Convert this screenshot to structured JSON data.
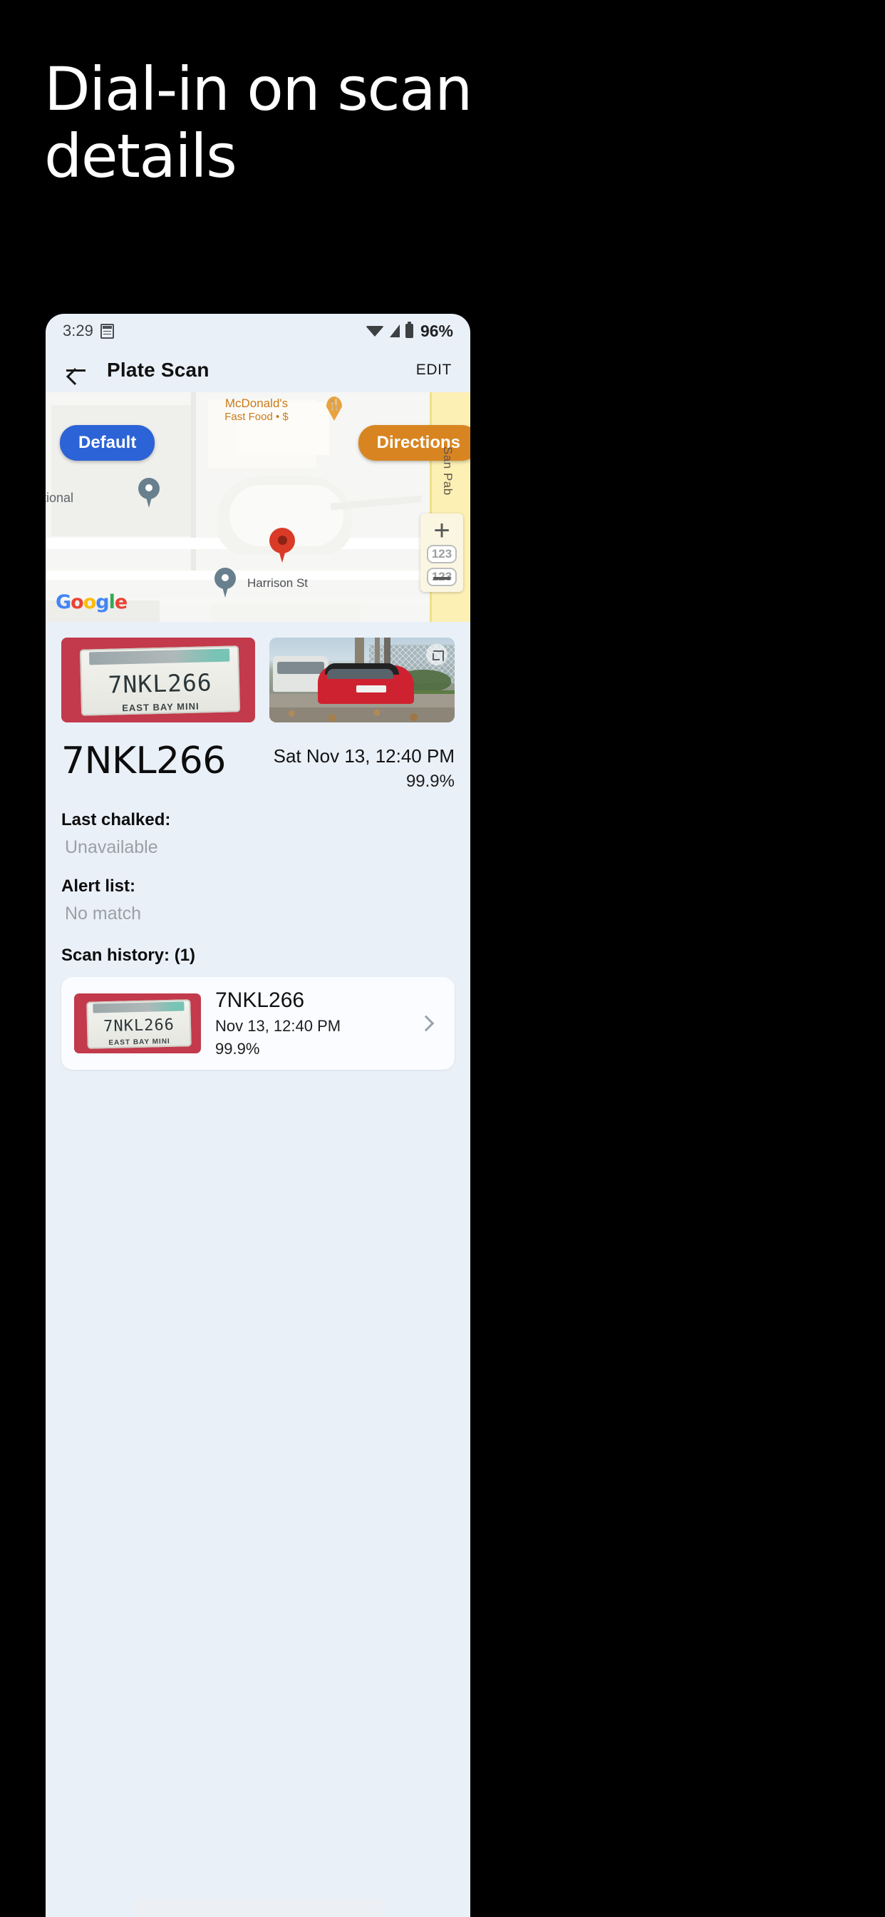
{
  "promo": {
    "headline": "Dial-in on scan details"
  },
  "status_bar": {
    "time": "3:29",
    "calendar_icon": "calendar-icon",
    "wifi_icon": "wifi-icon",
    "signal_icon": "cell-signal-icon",
    "battery_icon": "battery-icon",
    "battery_percent": "96%"
  },
  "app_bar": {
    "back_icon": "back-arrow-icon",
    "title": "Plate Scan",
    "action_label": "EDIT"
  },
  "map": {
    "default_button": "Default",
    "directions_button": "Directions",
    "poi_name": "McDonald's",
    "poi_subtitle": "Fast Food • $",
    "street_harrison": "Harrison St",
    "street_san_pablo": "San Pab",
    "label_partial": "tional",
    "attribution": "Google",
    "attribution_letters": [
      "G",
      "o",
      "o",
      "g",
      "l",
      "e"
    ],
    "zoom_in_label": "+",
    "shield_1": "123",
    "shield_2": "123",
    "pin_main_color": "#D93B27",
    "pin_other_color": "#68808E",
    "directions_color": "#D88521",
    "default_color": "#2C63D6"
  },
  "scan": {
    "plate_image_name": "license-plate-photo",
    "plate_text": "7NKL266",
    "plate_frame_text": "EAST BAY MINI",
    "vehicle_image_name": "vehicle-photo",
    "expand_icon": "expand-icon",
    "plate_number": "7NKL266",
    "timestamp": "Sat Nov 13, 12:40 PM",
    "confidence": "99.9%"
  },
  "fields": [
    {
      "label": "Last chalked:",
      "value": "Unavailable"
    },
    {
      "label": "Alert list:",
      "value": "No match"
    }
  ],
  "history": {
    "label": "Scan history: (1)",
    "items": [
      {
        "plate": "7NKL266",
        "date": "Nov 13, 12:40 PM",
        "confidence": "99.9%",
        "thumb_plate_text": "7NKL266",
        "thumb_frame_text": "EAST BAY MINI",
        "chevron_icon": "chevron-right-icon"
      }
    ]
  }
}
